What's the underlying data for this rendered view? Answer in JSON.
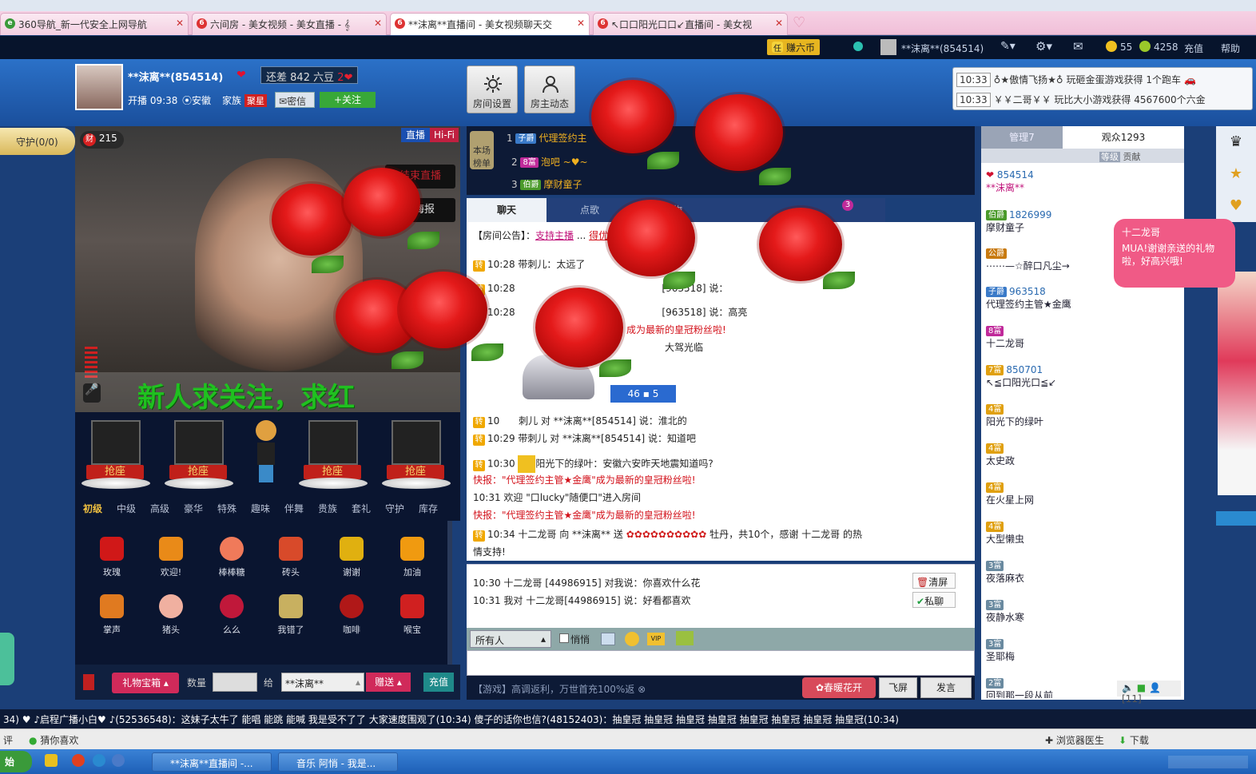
{
  "browser": {
    "tabs": [
      {
        "label": "360导航_新一代安全上网导航"
      },
      {
        "label": "六间房 - 美女视频 - 美女直播 - 𝄞"
      },
      {
        "label": "**沫离**直播间 - 美女视频聊天交"
      },
      {
        "label": "↖口口阳光口口↙直播间 - 美女视"
      }
    ]
  },
  "sitebar": {
    "coin_label": "赚六币",
    "user": "**沫离**(854514)",
    "coins": "55",
    "beans": "4258",
    "recharge": "充值",
    "help": "帮助"
  },
  "anchor": {
    "name": "**沫离**(854514)",
    "gap_label": "还差",
    "gap_value": "842",
    "gap_unit": "六豆",
    "level": "2",
    "start_label": "开播",
    "start_time": "09:38",
    "location": "安徽",
    "family_label": "家族",
    "family_tag": "聚星",
    "secret_btn": "密信",
    "follow_btn": "+关注"
  },
  "header_buttons": {
    "room_settings": "房间设置",
    "owner_dynamics": "房主动态"
  },
  "system_messages": [
    {
      "time": "10:33",
      "text": "♁★傲情飞扬★♁ 玩砸金蛋游戏获得 1个跑车"
    },
    {
      "time": "10:33",
      "text": "￥￥二哥￥￥ 玩比大小游戏获得 4567600个六金"
    }
  ],
  "video": {
    "guard": "守护(0/0)",
    "wealth": "215",
    "live_tag": "直播",
    "hifi_tag": "Hi-Fi",
    "end_live": "结束直播",
    "poster": "海报",
    "banner_text": "新人求关注，求红"
  },
  "seats": {
    "label": "抢座"
  },
  "gift_categories": [
    "初级",
    "中级",
    "高级",
    "豪华",
    "特殊",
    "趣味",
    "伴舞",
    "贵族",
    "套礼",
    "守护",
    "库存"
  ],
  "gifts": [
    {
      "name": "玫瑰",
      "color": "#d01818"
    },
    {
      "name": "欢迎!",
      "color": "#e98a18"
    },
    {
      "name": "棒棒糖",
      "color": "#f07a5a"
    },
    {
      "name": "砖头",
      "color": "#d84a2a"
    },
    {
      "name": "谢谢",
      "color": "#e0b010"
    },
    {
      "name": "加油",
      "color": "#f09a10"
    },
    {
      "name": "掌声",
      "color": "#e07a20"
    },
    {
      "name": "猪头",
      "color": "#f0b0a0"
    },
    {
      "name": "么么",
      "color": "#c0183a"
    },
    {
      "name": "我错了",
      "color": "#c8b060"
    },
    {
      "name": "咖啡",
      "color": "#b01818"
    },
    {
      "name": "喉宝",
      "color": "#d02020"
    }
  ],
  "giftbar": {
    "box": "礼物宝箱",
    "qty_label": "数量",
    "to_label": "给",
    "to_value": "**沫离**",
    "send": "赠送",
    "recharge": "充值"
  },
  "rank": {
    "title": "本场榜单",
    "rows": [
      {
        "rank": "1",
        "badge": "子爵",
        "name": "代理签约主"
      },
      {
        "rank": "2",
        "badge": "8富",
        "name": "泡吧 ~♥~"
      },
      {
        "rank": "3",
        "badge": "伯爵",
        "name": "摩财童子"
      }
    ]
  },
  "chat_tabs": [
    "聊天",
    "点歌",
    "礼物"
  ],
  "chat_tab_badge": "3",
  "chat": {
    "notice_prefix": "【房间公告】：",
    "notice_text": "支持主播",
    "notice_tail": "得优惠六币 VIP》",
    "lines": [
      {
        "time": "10:28",
        "text": "带刺儿：太远了"
      },
      {
        "time": "10:28",
        "text": "[963518] 说："
      },
      {
        "time": "10:28",
        "text": "[963518] 说：高亮"
      },
      {
        "time": "",
        "text": "成为最新的皇冠粉丝啦!"
      },
      {
        "time": "",
        "text": "大驾光临"
      },
      {
        "time": "10",
        "text": "刺儿 对 **沫离**[854514] 说：淮北的"
      },
      {
        "time": "10:29",
        "text": "带刺儿 对 **沫离**[854514] 说：知道吧"
      },
      {
        "time": "10:30",
        "text": "阳光下的绿叶：安徽六安昨天地震知道吗?"
      }
    ],
    "flash1": "快报：\"代理签约主管★金鹰\"成为最新的皇冠粉丝啦!",
    "welcome_time": "10:31",
    "welcome": "欢迎 \"口lucky\"随便口\"进入房间",
    "flash2": "快报：\"代理签约主管★金鹰\"成为最新的皇冠粉丝啦!",
    "gift_time": "10:34",
    "gift_text": "十二龙哥 向 **沫离** 送",
    "gift_tail": "牡丹，共10个，感谢 十二龙哥 的热",
    "gift_tail2": "情支持!",
    "car_num": "46",
    "car_num2": "5"
  },
  "private": {
    "lines": [
      {
        "time": "10:30",
        "text": "十二龙哥 [44986915] 对我说：你喜欢什么花"
      },
      {
        "time": "10:31",
        "text": "我对 十二龙哥[44986915] 说：好看都喜欢"
      }
    ],
    "clear": "清屏",
    "private_btn": "私聊"
  },
  "inputbar": {
    "target": "所有人",
    "whisper": "悄悄"
  },
  "bottom_chat": {
    "game": "【游戏】高调返利，万世首充100%返",
    "spring": "春暖花开",
    "fly": "飞屏",
    "send": "发言"
  },
  "right": {
    "tab_admin": "管理7",
    "tab_audience": "观众1293",
    "sub": "等级",
    "sub2": "贡献",
    "users": [
      {
        "badge": "",
        "id": "854514",
        "name": "**沫离**"
      },
      {
        "badge": "伯爵",
        "id": "1826999",
        "name": "摩财童子"
      },
      {
        "badge": "公爵",
        "id": "",
        "name": "⋯⋯—☆醉口凡尘→"
      },
      {
        "badge": "子爵",
        "id": "963518",
        "name": "代理签约主管★金鹰"
      },
      {
        "badge": "8富",
        "id": "",
        "name": "十二龙哥"
      },
      {
        "badge": "7富",
        "id": "850701",
        "name": "↖≦口阳光口≦↙"
      },
      {
        "badge": "4富",
        "id": "",
        "name": "阳光下的绿叶"
      },
      {
        "badge": "4富",
        "id": "",
        "name": "太史政"
      },
      {
        "badge": "4富",
        "id": "",
        "name": "在火星上网"
      },
      {
        "badge": "4富",
        "id": "",
        "name": "大型懒虫"
      },
      {
        "badge": "3富",
        "id": "",
        "name": "夜落麻衣"
      },
      {
        "badge": "3富",
        "id": "",
        "name": "夜静水寒"
      },
      {
        "badge": "3富",
        "id": "",
        "name": "圣耶梅"
      },
      {
        "badge": "2富",
        "id": "",
        "name": "回到那一段从前"
      }
    ],
    "count": "[11]"
  },
  "bubble": {
    "name": "十二龙哥",
    "text": "MUA!谢谢亲送的礼物啦，好高兴哦!"
  },
  "ticker": {
    "text": "34)    ♥ ♪启程广播小白♥ ♪(52536548)：这妹子太牛了 能唱 能跳 能喊 我是受不了了 大家速度围观了(10:34)      傻子的话你也信?(48152403)：抽皇冠 抽皇冠 抽皇冠 抽皇冠 抽皇冠 抽皇冠 抽皇冠 抽皇冠(10:34)"
  },
  "statusbar": {
    "left": "评",
    "like": "猜你喜欢",
    "doctor": "浏览器医生",
    "download": "下载"
  },
  "taskbar": {
    "start": "始",
    "tasks": [
      {
        "label": "**沫离**直播间 -..."
      },
      {
        "label": "音乐 阿悄 - 我是..."
      }
    ]
  }
}
